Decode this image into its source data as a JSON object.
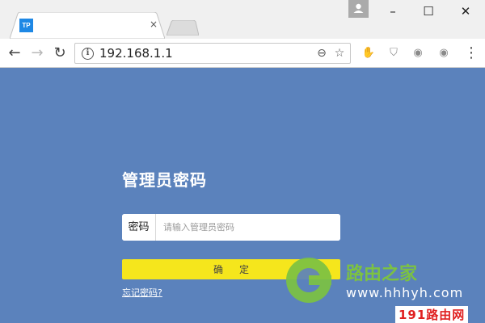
{
  "browser": {
    "tab": {
      "favicon_text": "TP",
      "close_glyph": "×"
    },
    "window_controls": {
      "minimize": "–",
      "maximize": "☐",
      "close": "✕"
    },
    "toolbar": {
      "back": "←",
      "forward": "→",
      "reload": "↻",
      "url": "192.168.1.1",
      "zoom_glyph": "⊖",
      "bookmark_glyph": "☆",
      "menu_glyph": "⋮"
    },
    "extension_icons": [
      "hand-icon",
      "shield-icon",
      "mask-icon",
      "mask2-icon"
    ]
  },
  "page": {
    "heading": "管理员密码",
    "password_label": "密码",
    "password_placeholder": "请输入管理员密码",
    "password_value": "",
    "confirm_label": "确定",
    "forgot_link": "忘记密码?"
  },
  "watermark": {
    "brand_text": "路由之家",
    "brand_url": "www.hhhyh.com",
    "corner_text": "191路由网"
  },
  "colors": {
    "page_background": "#5b82bc",
    "confirm_button": "#f5e61c",
    "tab_favicon": "#1e88e5",
    "brand_green": "#7cc242",
    "corner_red": "#e02020"
  }
}
